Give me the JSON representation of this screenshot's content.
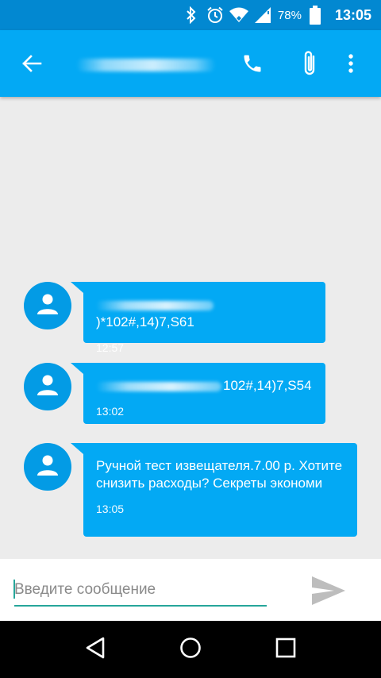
{
  "status_bar": {
    "battery_percent": "78%",
    "time": "13:05",
    "icons": [
      "bluetooth-icon",
      "alarm-icon",
      "wifi-icon",
      "signal-icon",
      "battery-icon"
    ]
  },
  "app_bar": {
    "contact_name": "",
    "actions": [
      "back-arrow-icon",
      "phone-icon",
      "attach-icon",
      "more-vert-icon"
    ]
  },
  "messages": [
    {
      "text_visible": ")*102#,14)7,S61",
      "time": "12:57"
    },
    {
      "text_visible": "102#,14)7,S54",
      "time": "13:02"
    },
    {
      "text": "Ручной тест извещателя.7.00 р. Хотите снизить расходы? Секреты экономи",
      "time": "13:05"
    }
  ],
  "composer": {
    "placeholder": "Введите сообщение",
    "value": ""
  },
  "colors": {
    "status_bar": "#0288d1",
    "app_bar": "#03a9f4",
    "bubble": "#03a9f4",
    "avatar": "#039be5",
    "accent": "#26a69a",
    "background": "#ececec"
  }
}
